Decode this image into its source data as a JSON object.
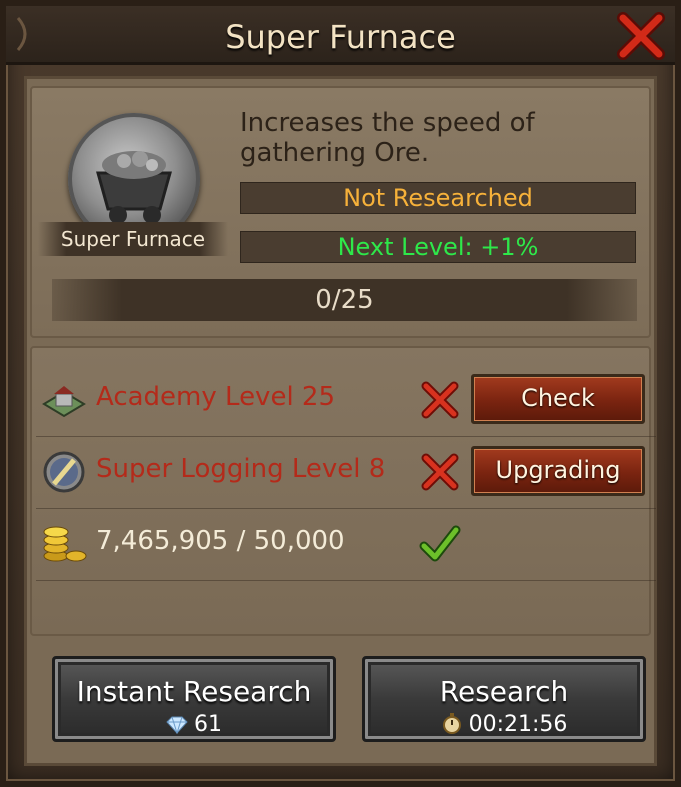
{
  "window": {
    "title": "Super Furnace"
  },
  "research": {
    "name": "Super Furnace",
    "description": "Increases the speed of gathering Ore.",
    "status": "Not Researched",
    "next_level": "Next Level: +1%",
    "progress": "0/25"
  },
  "requirements": [
    {
      "label": "Academy Level 25",
      "met": false,
      "button": "Check",
      "icon": "academy-building-icon"
    },
    {
      "label": "Super Logging Level 8",
      "met": false,
      "button": "Upgrading",
      "icon": "logging-tech-icon"
    },
    {
      "label": "7,465,905 / 50,000",
      "met": true,
      "icon": "gold-coins-icon"
    }
  ],
  "actions": {
    "instant": {
      "label": "Instant Research",
      "cost": "61",
      "icon": "diamond-icon"
    },
    "research": {
      "label": "Research",
      "time": "00:21:56",
      "icon": "stopwatch-icon"
    }
  },
  "colors": {
    "requirement_unmet": "#b42a1a",
    "status": "#f6b13a",
    "next_level": "#2ee84a"
  }
}
